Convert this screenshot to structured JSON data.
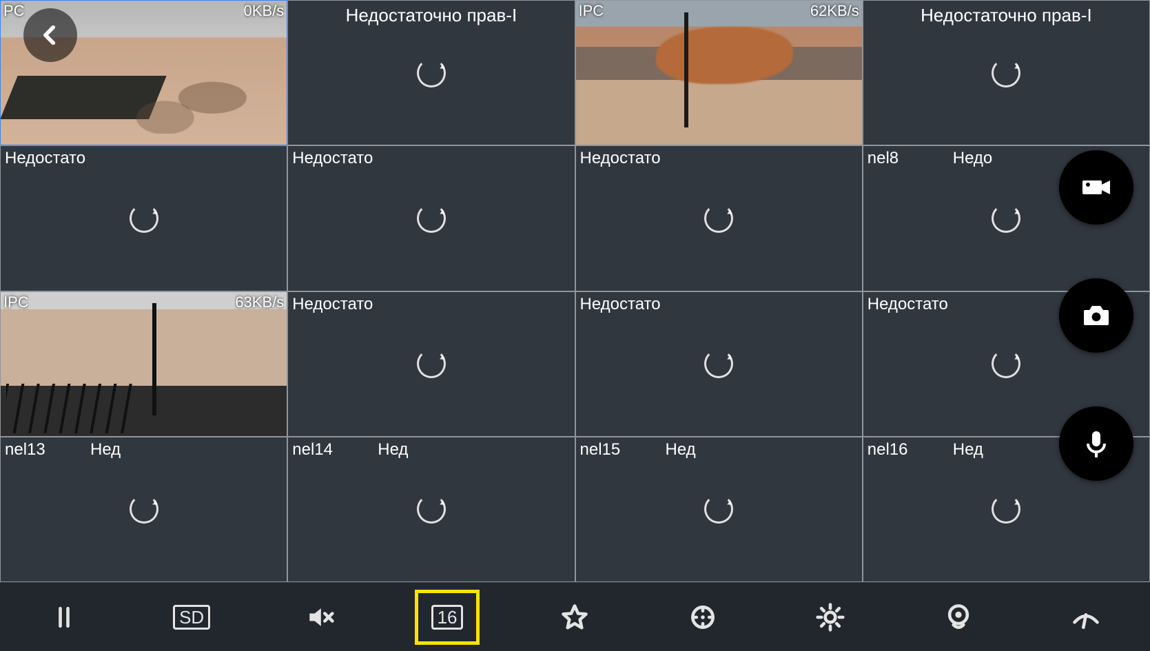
{
  "back_label": "Back",
  "tiles": [
    {
      "tl": "PC",
      "tr": "0KB/s",
      "scene": "parking",
      "selected": true,
      "spinner": false,
      "title": "",
      "left": "",
      "right": ""
    },
    {
      "tl": "",
      "tr": "",
      "scene": "",
      "selected": false,
      "spinner": true,
      "title": "Недостаточно прав-I",
      "left": "",
      "right": ""
    },
    {
      "tl": "IPC",
      "tr": "62KB/s",
      "scene": "yard",
      "selected": false,
      "spinner": false,
      "title": "",
      "left": "",
      "right": ""
    },
    {
      "tl": "",
      "tr": "",
      "scene": "",
      "selected": false,
      "spinner": true,
      "title": "Недостаточно прав-I",
      "left": "",
      "right": ""
    },
    {
      "tl": "",
      "tr": "",
      "scene": "",
      "selected": false,
      "spinner": true,
      "title": "",
      "left": "Недостато",
      "right": ""
    },
    {
      "tl": "",
      "tr": "",
      "scene": "",
      "selected": false,
      "spinner": true,
      "title": "",
      "left": "Недостато",
      "right": ""
    },
    {
      "tl": "",
      "tr": "",
      "scene": "",
      "selected": false,
      "spinner": true,
      "title": "",
      "left": "Недостато",
      "right": ""
    },
    {
      "tl": "",
      "tr": "",
      "scene": "",
      "selected": false,
      "spinner": true,
      "title": "",
      "left": "nel8",
      "right": "Недо"
    },
    {
      "tl": "IPC",
      "tr": "63KB/s",
      "scene": "ramp",
      "selected": false,
      "spinner": false,
      "title": "",
      "left": "",
      "right": ""
    },
    {
      "tl": "",
      "tr": "",
      "scene": "",
      "selected": false,
      "spinner": true,
      "title": "",
      "left": "Недостато",
      "right": ""
    },
    {
      "tl": "",
      "tr": "",
      "scene": "",
      "selected": false,
      "spinner": true,
      "title": "",
      "left": "Недостато",
      "right": ""
    },
    {
      "tl": "",
      "tr": "",
      "scene": "",
      "selected": false,
      "spinner": true,
      "title": "",
      "left": "Недостато",
      "right": ""
    },
    {
      "tl": "",
      "tr": "",
      "scene": "",
      "selected": false,
      "spinner": true,
      "title": "",
      "left": "nel13",
      "right": "Нед"
    },
    {
      "tl": "",
      "tr": "",
      "scene": "",
      "selected": false,
      "spinner": true,
      "title": "",
      "left": "nel14",
      "right": "Нед"
    },
    {
      "tl": "",
      "tr": "",
      "scene": "",
      "selected": false,
      "spinner": true,
      "title": "",
      "left": "nel15",
      "right": "Нед"
    },
    {
      "tl": "",
      "tr": "",
      "scene": "",
      "selected": false,
      "spinner": true,
      "title": "",
      "left": "nel16",
      "right": "Нед"
    }
  ],
  "fabs": {
    "record": "record-video",
    "snapshot": "snapshot-camera",
    "mic": "microphone"
  },
  "toolbar": {
    "pause": "pause",
    "quality": "SD",
    "mute": "mute",
    "layout": "16",
    "favorite": "favorite",
    "focus": "center-focus",
    "brightness": "brightness",
    "fisheye": "fisheye",
    "wiper": "wiper"
  }
}
